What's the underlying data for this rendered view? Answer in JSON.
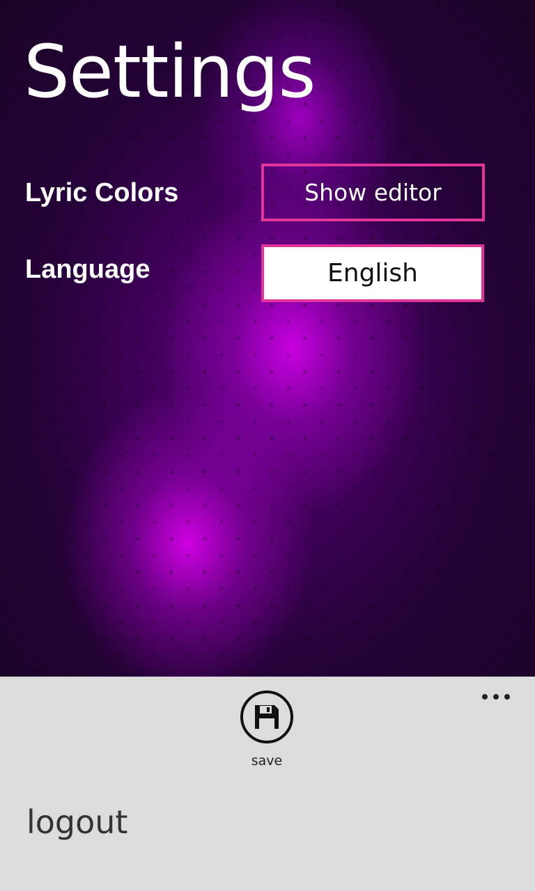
{
  "header": {
    "title": "Settings"
  },
  "settings": {
    "lyric_colors": {
      "label": "Lyric Colors",
      "button_label": "Show editor"
    },
    "language": {
      "label": "Language",
      "selected": "English"
    }
  },
  "app_bar": {
    "save": {
      "icon": "save-icon",
      "label": "save"
    },
    "more_icon": "more-icon",
    "menu_items": [
      {
        "label": "logout"
      }
    ]
  },
  "colors": {
    "accent_border": "#e3349a",
    "app_bar_background": "#dcdcdc",
    "page_background": "#5a0a78"
  }
}
